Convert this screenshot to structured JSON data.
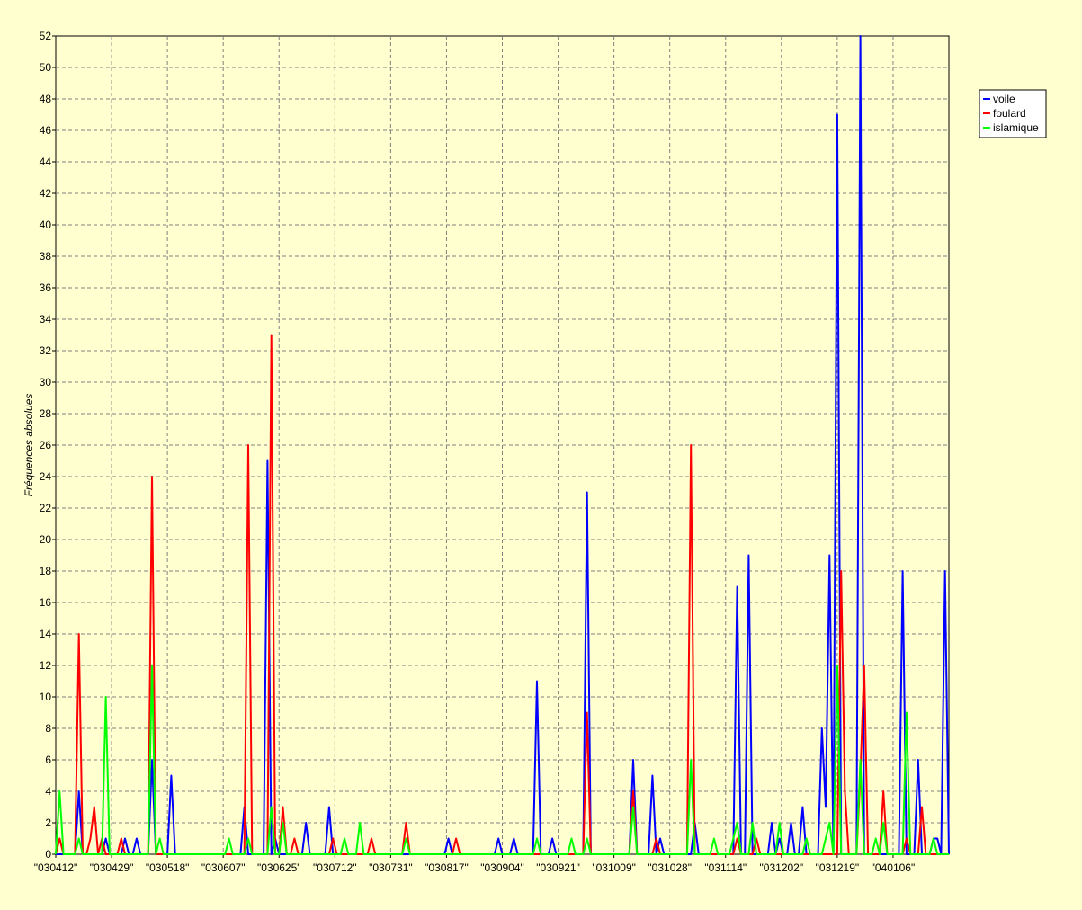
{
  "chart_data": {
    "type": "line",
    "title": "",
    "xlabel": "",
    "ylabel": "Fréquences absolues",
    "ylim": [
      0,
      52
    ],
    "yticks": [
      0,
      2,
      4,
      6,
      8,
      10,
      12,
      14,
      16,
      18,
      20,
      22,
      24,
      26,
      28,
      30,
      32,
      34,
      36,
      38,
      40,
      42,
      44,
      46,
      48,
      50,
      52
    ],
    "xtick_labels": [
      "\"030412\"",
      "\"030429\"",
      "\"030518\"",
      "\"030607\"",
      "\"030625\"",
      "\"030712\"",
      "\"030731\"",
      "\"030817\"",
      "\"030904\"",
      "\"030921\"",
      "\"031009\"",
      "\"031028\"",
      "\"031114\"",
      "\"031202\"",
      "\"031219\"",
      "\"040106\""
    ],
    "x_count": 232,
    "grid": true,
    "legend_position": "right",
    "background": "#ffffd0",
    "series": [
      {
        "name": "voile",
        "color": "#0000ff",
        "points": [
          [
            0,
            0
          ],
          [
            5,
            0
          ],
          [
            6,
            4
          ],
          [
            7,
            0
          ],
          [
            12,
            0
          ],
          [
            13,
            1
          ],
          [
            14,
            0
          ],
          [
            17,
            0
          ],
          [
            18,
            1
          ],
          [
            19,
            0
          ],
          [
            20,
            0
          ],
          [
            21,
            1
          ],
          [
            22,
            0
          ],
          [
            24,
            0
          ],
          [
            25,
            6
          ],
          [
            26,
            0
          ],
          [
            29,
            0
          ],
          [
            30,
            5
          ],
          [
            31,
            0
          ],
          [
            48,
            0
          ],
          [
            49,
            3
          ],
          [
            50,
            0
          ],
          [
            54,
            0
          ],
          [
            55,
            25
          ],
          [
            56,
            0
          ],
          [
            57,
            1
          ],
          [
            58,
            0
          ],
          [
            64,
            0
          ],
          [
            65,
            2
          ],
          [
            66,
            0
          ],
          [
            70,
            0
          ],
          [
            71,
            3
          ],
          [
            72,
            0
          ],
          [
            101,
            0
          ],
          [
            102,
            1
          ],
          [
            103,
            0
          ],
          [
            114,
            0
          ],
          [
            115,
            1
          ],
          [
            116,
            0
          ],
          [
            118,
            0
          ],
          [
            119,
            1
          ],
          [
            120,
            0
          ],
          [
            124,
            0
          ],
          [
            125,
            11
          ],
          [
            126,
            0
          ],
          [
            128,
            0
          ],
          [
            129,
            1
          ],
          [
            130,
            0
          ],
          [
            137,
            0
          ],
          [
            138,
            23
          ],
          [
            139,
            0
          ],
          [
            149,
            0
          ],
          [
            150,
            6
          ],
          [
            151,
            0
          ],
          [
            154,
            0
          ],
          [
            155,
            5
          ],
          [
            156,
            0
          ],
          [
            157,
            1
          ],
          [
            158,
            0
          ],
          [
            165,
            0
          ],
          [
            166,
            2
          ],
          [
            167,
            0
          ],
          [
            176,
            0
          ],
          [
            177,
            17
          ],
          [
            178,
            0
          ],
          [
            179,
            0
          ],
          [
            180,
            19
          ],
          [
            181,
            0
          ],
          [
            185,
            0
          ],
          [
            186,
            2
          ],
          [
            187,
            0
          ],
          [
            188,
            1
          ],
          [
            189,
            0
          ],
          [
            190,
            0
          ],
          [
            191,
            2
          ],
          [
            192,
            0
          ],
          [
            193,
            0
          ],
          [
            194,
            3
          ],
          [
            195,
            0
          ],
          [
            198,
            0
          ],
          [
            199,
            8
          ],
          [
            200,
            3
          ],
          [
            201,
            19
          ],
          [
            202,
            0
          ],
          [
            203,
            47
          ],
          [
            204,
            0
          ],
          [
            208,
            0
          ],
          [
            209,
            52
          ],
          [
            210,
            0
          ],
          [
            219,
            0
          ],
          [
            220,
            18
          ],
          [
            221,
            0
          ],
          [
            223,
            0
          ],
          [
            224,
            6
          ],
          [
            225,
            0
          ],
          [
            227,
            0
          ],
          [
            228,
            1
          ],
          [
            229,
            1
          ],
          [
            230,
            0
          ],
          [
            231,
            18
          ],
          [
            232,
            0
          ]
        ]
      },
      {
        "name": "foulard",
        "color": "#ff0000",
        "points": [
          [
            0,
            0
          ],
          [
            1,
            1
          ],
          [
            2,
            0
          ],
          [
            5,
            0
          ],
          [
            6,
            14
          ],
          [
            7,
            0
          ],
          [
            8,
            0
          ],
          [
            9,
            1
          ],
          [
            10,
            3
          ],
          [
            11,
            0
          ],
          [
            12,
            1
          ],
          [
            13,
            0
          ],
          [
            16,
            0
          ],
          [
            17,
            1
          ],
          [
            18,
            0
          ],
          [
            24,
            0
          ],
          [
            25,
            24
          ],
          [
            26,
            0
          ],
          [
            49,
            0
          ],
          [
            50,
            26
          ],
          [
            51,
            0
          ],
          [
            55,
            0
          ],
          [
            56,
            33
          ],
          [
            57,
            0
          ],
          [
            58,
            0
          ],
          [
            59,
            3
          ],
          [
            60,
            0
          ],
          [
            61,
            0
          ],
          [
            62,
            1
          ],
          [
            63,
            0
          ],
          [
            71,
            0
          ],
          [
            72,
            1
          ],
          [
            73,
            0
          ],
          [
            81,
            0
          ],
          [
            82,
            1
          ],
          [
            83,
            0
          ],
          [
            90,
            0
          ],
          [
            91,
            2
          ],
          [
            92,
            0
          ],
          [
            103,
            0
          ],
          [
            104,
            1
          ],
          [
            105,
            0
          ],
          [
            137,
            0
          ],
          [
            138,
            9
          ],
          [
            139,
            0
          ],
          [
            149,
            0
          ],
          [
            150,
            4
          ],
          [
            151,
            0
          ],
          [
            155,
            0
          ],
          [
            156,
            1
          ],
          [
            157,
            0
          ],
          [
            164,
            0
          ],
          [
            165,
            26
          ],
          [
            166,
            0
          ],
          [
            176,
            0
          ],
          [
            177,
            1
          ],
          [
            178,
            0
          ],
          [
            181,
            0
          ],
          [
            182,
            1
          ],
          [
            183,
            0
          ],
          [
            203,
            0
          ],
          [
            204,
            18
          ],
          [
            205,
            4
          ],
          [
            206,
            0
          ],
          [
            208,
            0
          ],
          [
            209,
            5
          ],
          [
            210,
            12
          ],
          [
            211,
            0
          ],
          [
            214,
            0
          ],
          [
            215,
            4
          ],
          [
            216,
            0
          ],
          [
            220,
            0
          ],
          [
            221,
            1
          ],
          [
            222,
            0
          ],
          [
            224,
            0
          ],
          [
            225,
            3
          ],
          [
            226,
            0
          ],
          [
            232,
            0
          ]
        ]
      },
      {
        "name": "islamique",
        "color": "#00ff00",
        "points": [
          [
            0,
            0
          ],
          [
            1,
            4
          ],
          [
            2,
            0
          ],
          [
            5,
            0
          ],
          [
            6,
            1
          ],
          [
            7,
            0
          ],
          [
            12,
            0
          ],
          [
            13,
            10
          ],
          [
            14,
            0
          ],
          [
            24,
            0
          ],
          [
            25,
            12
          ],
          [
            26,
            0
          ],
          [
            27,
            1
          ],
          [
            28,
            0
          ],
          [
            44,
            0
          ],
          [
            45,
            1
          ],
          [
            46,
            0
          ],
          [
            49,
            0
          ],
          [
            50,
            1
          ],
          [
            51,
            0
          ],
          [
            55,
            0
          ],
          [
            56,
            3
          ],
          [
            57,
            0
          ],
          [
            58,
            0
          ],
          [
            59,
            2
          ],
          [
            60,
            0
          ],
          [
            74,
            0
          ],
          [
            75,
            1
          ],
          [
            76,
            0
          ],
          [
            78,
            0
          ],
          [
            79,
            2
          ],
          [
            80,
            0
          ],
          [
            90,
            0
          ],
          [
            91,
            1
          ],
          [
            92,
            0
          ],
          [
            124,
            0
          ],
          [
            125,
            1
          ],
          [
            126,
            0
          ],
          [
            133,
            0
          ],
          [
            134,
            1
          ],
          [
            135,
            0
          ],
          [
            137,
            0
          ],
          [
            138,
            1
          ],
          [
            139,
            0
          ],
          [
            149,
            0
          ],
          [
            150,
            3
          ],
          [
            151,
            0
          ],
          [
            164,
            0
          ],
          [
            165,
            6
          ],
          [
            166,
            0
          ],
          [
            170,
            0
          ],
          [
            171,
            1
          ],
          [
            172,
            0
          ],
          [
            175,
            0
          ],
          [
            176,
            1
          ],
          [
            177,
            2
          ],
          [
            178,
            0
          ],
          [
            180,
            0
          ],
          [
            181,
            2
          ],
          [
            182,
            0
          ],
          [
            187,
            0
          ],
          [
            188,
            2
          ],
          [
            189,
            0
          ],
          [
            194,
            0
          ],
          [
            195,
            1
          ],
          [
            196,
            0
          ],
          [
            199,
            0
          ],
          [
            200,
            1
          ],
          [
            201,
            2
          ],
          [
            202,
            0
          ],
          [
            203,
            12
          ],
          [
            204,
            0
          ],
          [
            208,
            0
          ],
          [
            209,
            6
          ],
          [
            210,
            0
          ],
          [
            212,
            0
          ],
          [
            213,
            1
          ],
          [
            214,
            0
          ],
          [
            215,
            2
          ],
          [
            216,
            0
          ],
          [
            220,
            0
          ],
          [
            221,
            9
          ],
          [
            222,
            0
          ],
          [
            227,
            0
          ],
          [
            228,
            1
          ],
          [
            229,
            0
          ],
          [
            232,
            0
          ]
        ]
      }
    ]
  }
}
